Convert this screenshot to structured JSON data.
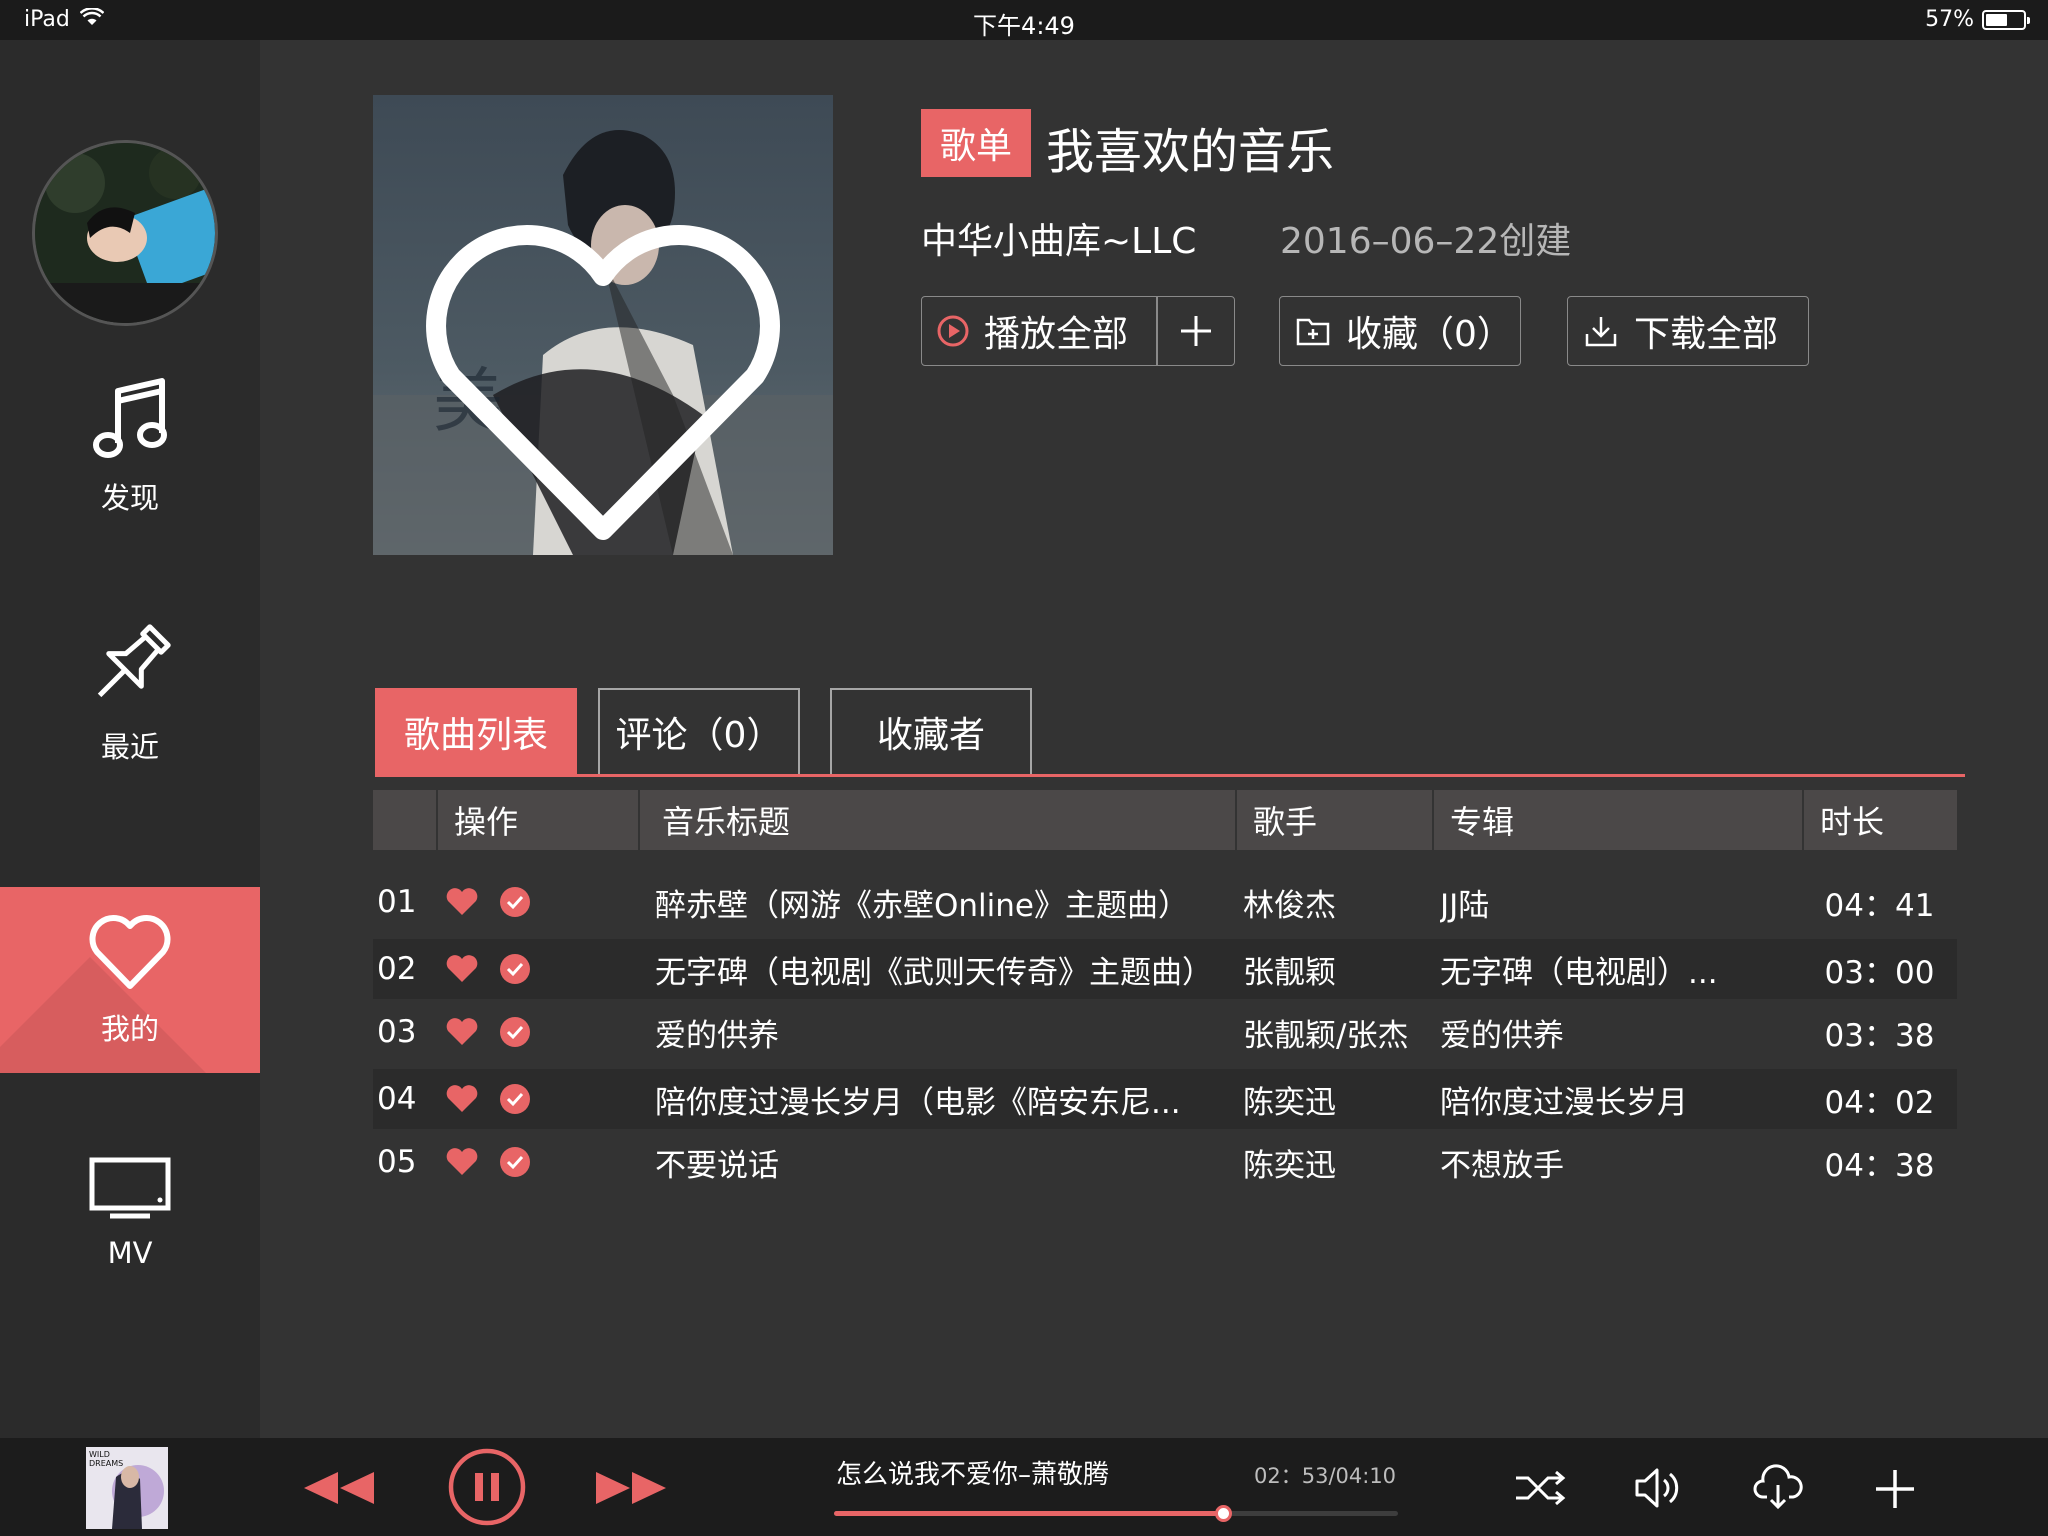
{
  "status_bar": {
    "device": "iPad",
    "time": "下午4:49",
    "battery": "57%",
    "battery_level": 0.57
  },
  "sidebar": {
    "items": [
      {
        "label": "发现",
        "icon": "music-note-icon"
      },
      {
        "label": "最近",
        "icon": "pin-icon"
      },
      {
        "label": "我的",
        "icon": "heart-outline-icon",
        "active": true
      },
      {
        "label": "MV",
        "icon": "tv-icon"
      }
    ]
  },
  "playlist": {
    "tag": "歌单",
    "title": "我喜欢的音乐",
    "creator": "中华小曲库~LLC",
    "created": "2016–06–22创建",
    "buttons": {
      "play_all": "播放全部",
      "add": "+",
      "favorite": "收藏（0）",
      "download_all": "下载全部"
    }
  },
  "tabs": [
    {
      "label": "歌曲列表",
      "active": true
    },
    {
      "label": "评论（0）",
      "active": false
    },
    {
      "label": "收藏者",
      "active": false
    }
  ],
  "table": {
    "headers": {
      "action": "操作",
      "title": "音乐标题",
      "artist": "歌手",
      "album": "专辑",
      "duration": "时长"
    },
    "rows": [
      {
        "no": "01",
        "title": "醉赤壁（网游《赤壁Online》主题曲）",
        "artist": "林俊杰",
        "album": "JJ陆",
        "duration": "04：41"
      },
      {
        "no": "02",
        "title": "无字碑（电视剧《武则天传奇》主题曲）",
        "artist": "张靓颖",
        "album": "无字碑（电视剧）...",
        "duration": "03：00"
      },
      {
        "no": "03",
        "title": "爱的供养",
        "artist": "张靓颖/张杰",
        "album": "爱的供养",
        "duration": "03：38"
      },
      {
        "no": "04",
        "title": "陪你度过漫长岁月（电影《陪安东尼...",
        "artist": "陈奕迅",
        "album": "陪你度过漫长岁月",
        "duration": "04：02"
      },
      {
        "no": "05",
        "title": "不要说话",
        "artist": "陈奕迅",
        "album": "不想放手",
        "duration": "04：38"
      }
    ]
  },
  "player": {
    "now_playing": "怎么说我不爱你–萧敬腾",
    "time": "02：53/04:10",
    "progress": 0.69,
    "mini_cover_text": "WILD DREAMS"
  },
  "colors": {
    "accent": "#e86566",
    "background": "#333333",
    "sidebar": "#2b2b2b",
    "player": "#1c1c1c"
  }
}
